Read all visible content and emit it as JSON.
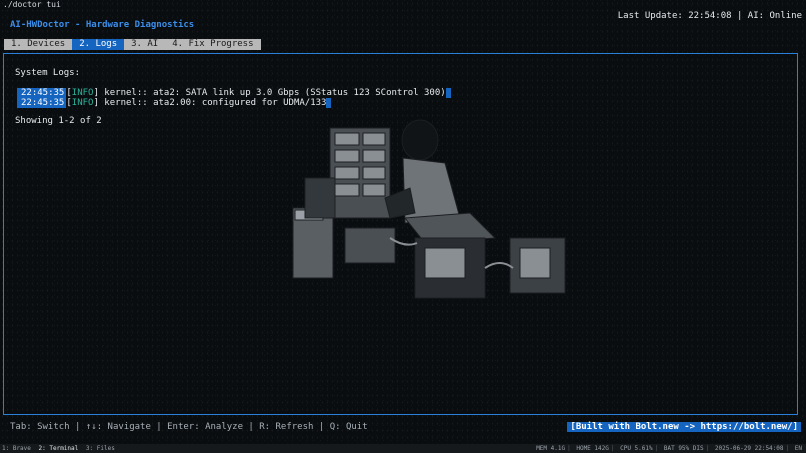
{
  "window": {
    "title": "./doctor tui"
  },
  "header": {
    "app_title": "AI-HWDoctor - Hardware Diagnostics",
    "status": "Last Update: 22:54:08 | AI: Online"
  },
  "tabs": [
    {
      "label": "1. Devices",
      "active": false
    },
    {
      "label": "2. Logs",
      "active": true
    },
    {
      "label": "3. AI",
      "active": false
    },
    {
      "label": "4. Fix Progress",
      "active": false
    }
  ],
  "logs": {
    "section_title": "System Logs:",
    "entries": [
      {
        "time": "22:45:35",
        "level": "INFO",
        "message": " kernel:: ata2: SATA link up 3.0 Gbps (SStatus 123 SControl 300)"
      },
      {
        "time": "22:45:35",
        "level": "INFO",
        "message": " kernel:: ata2.00: configured for UDMA/133"
      }
    ],
    "showing": "Showing 1-2 of 2"
  },
  "footer": {
    "help": "Tab: Switch | ↑↓: Navigate | Enter: Analyze | R: Refresh | Q: Quit",
    "built_with": "[Built with Bolt.new -> https://bolt.new/]"
  },
  "tmux": {
    "windows": [
      {
        "label": "1: Brave",
        "active": false
      },
      {
        "label": "2: Terminal",
        "active": true
      },
      {
        "label": "3: Files",
        "active": false
      }
    ],
    "mem": "MEM 4.1G",
    "home": "HOME 142G",
    "cpu": "CPU 5.61%",
    "bat": "BAT 95% DIS",
    "datetime": "2025-06-29 22:54:08",
    "lang": "EN"
  },
  "colors": {
    "accent": "#1565c0",
    "border": "#2a7fd8",
    "info": "#2bb39a",
    "background": "#0a0d10"
  }
}
